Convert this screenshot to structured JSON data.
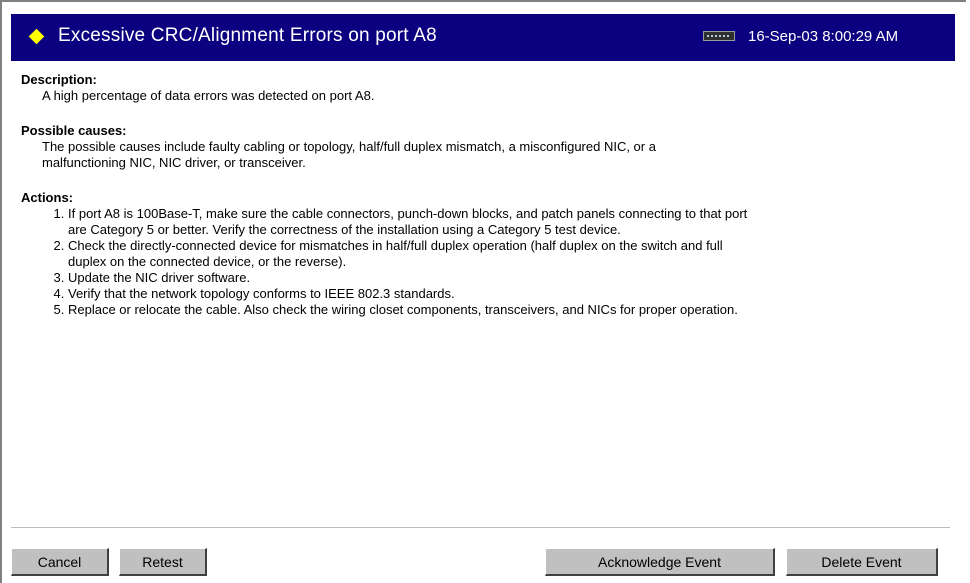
{
  "header": {
    "title": "Excessive CRC/Alignment Errors on port A8",
    "timestamp": "16-Sep-03 8:00:29 AM",
    "status_icon": "yellow-diamond",
    "device_icon": "switch-device-icon",
    "background_color": "#0b007f",
    "accent_color": "#ffff00"
  },
  "description": {
    "heading": "Description:",
    "text": "A high percentage of data errors was detected on port A8."
  },
  "possible_causes": {
    "heading": "Possible causes:",
    "line1": "The possible causes include faulty cabling or topology, half/full duplex mismatch, a misconfigured NIC, or a",
    "line2": "malfunctioning NIC, NIC driver, or transceiver."
  },
  "actions": {
    "heading": "Actions:",
    "items": [
      {
        "line1": "If port A8 is 100Base-T, make sure the cable connectors, punch-down blocks, and patch panels connecting to that port",
        "line2": "are Category 5 or better. Verify the correctness of the installation using a Category 5 test device."
      },
      {
        "line1": "Check the directly-connected device for mismatches in half/full duplex operation (half duplex on the switch and full",
        "line2": "duplex on the connected device, or the reverse)."
      },
      {
        "line1": "Update the NIC driver software."
      },
      {
        "line1": "Verify that the network topology conforms to IEEE 802.3 standards."
      },
      {
        "line1": "Replace or relocate the cable. Also check the wiring closet components, transceivers, and NICs for proper operation."
      }
    ]
  },
  "buttons": {
    "cancel": "Cancel",
    "retest": "Retest",
    "acknowledge": "Acknowledge Event",
    "delete": "Delete Event"
  }
}
